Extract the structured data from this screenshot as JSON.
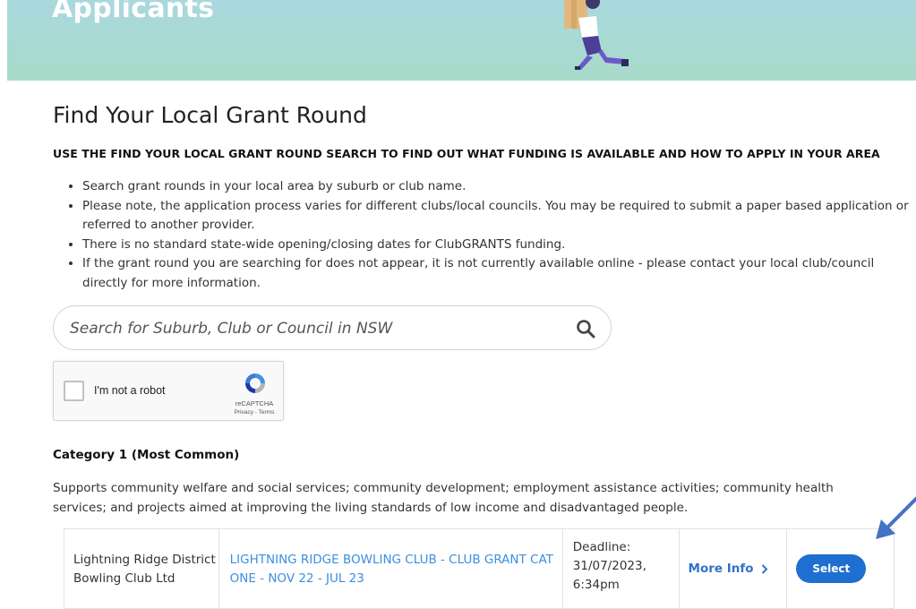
{
  "banner": {
    "title": "Applicants"
  },
  "page": {
    "title": "Find Your Local Grant Round",
    "subheading": "USE THE FIND YOUR LOCAL GRANT ROUND SEARCH TO FIND OUT WHAT FUNDING IS AVAILABLE AND HOW TO APPLY IN YOUR AREA",
    "notes": [
      "Search grant rounds in your local area by suburb or club name.",
      "Please note, the application process varies for different clubs/local councils. You may be required to submit a paper based application or referred to another provider.",
      "There is no standard state-wide opening/closing dates for ClubGRANTS funding.",
      "If the grant round you are searching for does not appear, it is not currently available online - please contact your local club/council directly for more information."
    ]
  },
  "search": {
    "placeholder": "Search for Suburb, Club or Council in NSW",
    "value": "",
    "icon": "search-icon"
  },
  "captcha": {
    "label": "I'm not a robot",
    "brand": "reCAPTCHA",
    "links": "Privacy - Terms",
    "checked": false
  },
  "category": {
    "title": "Category 1 (Most Common)",
    "description": "Supports community welfare and social services; community development; employment assistance activities; community health services; and projects aimed at improving the living standards of low income and disadvantaged people."
  },
  "results": [
    {
      "club": "Lightning Ridge District Bowling Club Ltd",
      "round": "LIGHTNING RIDGE BOWLING CLUB - CLUB GRANT CAT ONE - NOV 22 - JUL 23",
      "deadline_label": "Deadline:",
      "deadline_date": "31/07/2023,",
      "deadline_time": "6:34pm",
      "more_info": "More Info",
      "select": "Select"
    }
  ],
  "colors": {
    "accent": "#1e6fcf",
    "link": "#3b8fe0",
    "annotation_arrow": "#4472c4"
  }
}
